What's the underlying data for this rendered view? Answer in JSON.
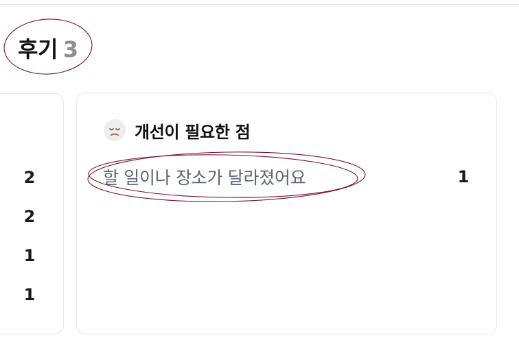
{
  "reviews": {
    "title": "후기",
    "count": "3"
  },
  "left_card": {
    "counts": [
      "2",
      "2",
      "1",
      "1"
    ]
  },
  "improvement_card": {
    "icon": "frown-face-icon",
    "title": "개선이 필요한 점",
    "items": [
      {
        "label": "할 일이나 장소가 달라졌어요",
        "count": "1"
      }
    ]
  },
  "annotation_color": "#7a1030"
}
